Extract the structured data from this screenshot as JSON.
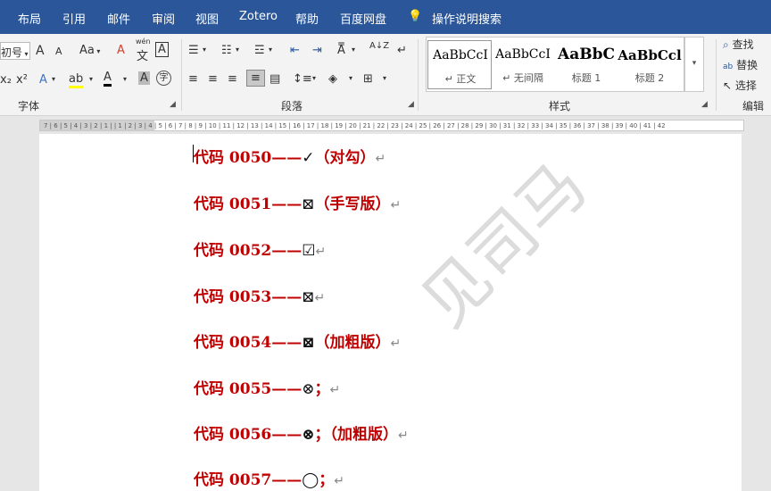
{
  "menu": [
    "布局",
    "引用",
    "邮件",
    "审阅",
    "视图",
    "Zotero",
    "帮助",
    "百度网盘"
  ],
  "search_label": "操作说明搜索",
  "font": {
    "size_value": "初号",
    "grow": "A",
    "shrink": "A",
    "case": "Aa",
    "clear": "A",
    "phonetic_top": "wén",
    "phonetic": "文",
    "border_char": "A",
    "subscript": "x₂",
    "superscript": "x²",
    "effects": "A",
    "highlight": "ab",
    "font_color": "A",
    "char_shade": "A",
    "circled": "字",
    "group_label": "字体"
  },
  "paragraph": {
    "group_label": "段落",
    "sort": "A↓Z"
  },
  "styles": {
    "group_label": "样式",
    "items": [
      {
        "sample": "AaBbCcI",
        "name": "↵ 正文"
      },
      {
        "sample": "AaBbCcI",
        "name": "↵ 无间隔"
      },
      {
        "sample": "AaBbC",
        "name": "标题 1"
      },
      {
        "sample": "AaBbCcl",
        "name": "标题 2"
      }
    ]
  },
  "editing": {
    "group_label": "编辑",
    "find": "查找",
    "replace": "替换",
    "select": "选择"
  },
  "ruler_text": "7 | 6 | 5 | 4 | 3 | 2 | 1 |   | 1 | 2 | 3 | 4 | 5 | 6 | 7 | 8 | 9 | 10 | 11 | 12 | 13 | 14 | 15 | 16 | 17 | 18 | 19 | 20 | 21 | 22 | 23 | 24 | 25 | 26 | 27 | 28 | 29 | 30 | 31 | 32 | 33 | 34 | 35 | 36 | 37 | 38 | 39 | 40 | 41 | 42",
  "watermark": "见司马",
  "lines": [
    {
      "code": "代码 0050——",
      "mark": "✓",
      "note": "（对勾）"
    },
    {
      "code": "代码 0051——",
      "mark": "⊠",
      "note": "（手写版）"
    },
    {
      "code": "代码 0052——",
      "mark": "☑",
      "note": ""
    },
    {
      "code": "代码 0053——",
      "mark": "⊠",
      "note": ""
    },
    {
      "code": "代码 0054——",
      "mark": "⊠",
      "note": "（加粗版）"
    },
    {
      "code": "代码 0055——",
      "mark": "⊗",
      "note": "；"
    },
    {
      "code": "代码 0056——",
      "mark": "⊗",
      "note": "；（加粗版）"
    },
    {
      "code": "代码 0057——",
      "mark": "◯",
      "note": "；"
    }
  ],
  "para_mark": "↵"
}
